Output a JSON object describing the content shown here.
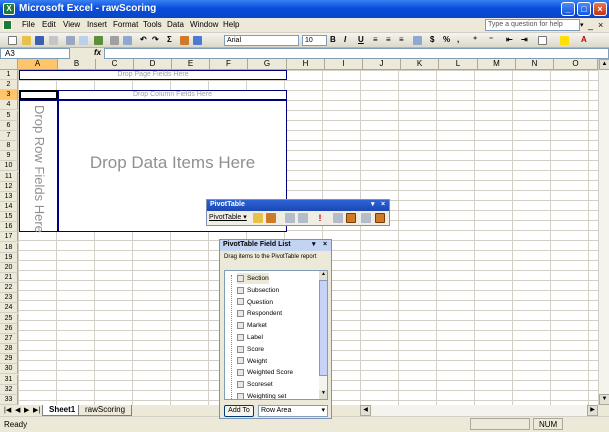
{
  "window": {
    "title": "Microsoft Excel - rawScoring",
    "app_icon": "X"
  },
  "menu": {
    "items": [
      "File",
      "Edit",
      "View",
      "Insert",
      "Format",
      "Tools",
      "Data",
      "Window",
      "Help"
    ],
    "help_placeholder": "Type a question for help"
  },
  "toolbar": {
    "font": "Arial",
    "size": "10",
    "bold": "B",
    "italic": "I",
    "underline": "U",
    "percent": "%"
  },
  "formula": {
    "name_box": "A3",
    "fx": "fx"
  },
  "grid": {
    "columns": [
      "A",
      "B",
      "C",
      "D",
      "E",
      "F",
      "G",
      "H",
      "I",
      "J",
      "K",
      "L",
      "M",
      "N",
      "O"
    ],
    "rows": [
      "1",
      "2",
      "3",
      "4",
      "5",
      "6",
      "7",
      "8",
      "9",
      "10",
      "11",
      "12",
      "13",
      "14",
      "15",
      "16",
      "17",
      "18",
      "19",
      "20",
      "21",
      "22",
      "23",
      "24",
      "25",
      "26",
      "27",
      "28",
      "29",
      "30",
      "31",
      "32",
      "33"
    ],
    "selected_column": "A",
    "selected_row": "3"
  },
  "pivot": {
    "page_fields": "Drop Page Fields Here",
    "column_fields": "Drop Column Fields Here",
    "row_fields": "Drop Row Fields Here",
    "data_items": "Drop Data Items Here"
  },
  "pivot_toolbar": {
    "title": "PivotTable",
    "menu_label": "PivotTable ▾"
  },
  "field_list": {
    "title": "PivotTable Field List",
    "instruction": "Drag items to the PivotTable report",
    "fields": [
      "Section",
      "Subsection",
      "Question",
      "Respondent",
      "Market",
      "Label",
      "Score",
      "Weight",
      "Weighted Score",
      "Scoreset",
      "Weighting set"
    ],
    "add_button": "Add To",
    "area": "Row Area"
  },
  "sheets": [
    "Sheet1",
    "rawScoring"
  ],
  "status": {
    "left": "Ready",
    "num": "NUM"
  },
  "colors": {
    "title_blue": "#0a4ddb",
    "pivot_border": "#00007f",
    "selection": "#ffc56b"
  }
}
